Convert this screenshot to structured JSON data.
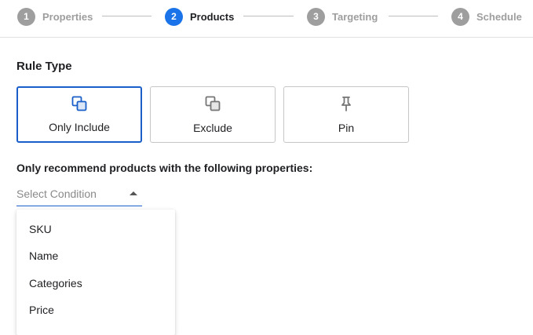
{
  "stepper": {
    "steps": [
      {
        "number": "1",
        "label": "Properties",
        "state": "inactive"
      },
      {
        "number": "2",
        "label": "Products",
        "state": "active"
      },
      {
        "number": "3",
        "label": "Targeting",
        "state": "inactive"
      },
      {
        "number": "4",
        "label": "Schedule",
        "state": "inactive"
      }
    ]
  },
  "rule_type": {
    "title": "Rule Type",
    "options": [
      {
        "label": "Only Include",
        "icon": "layers-filled-icon",
        "selected": true
      },
      {
        "label": "Exclude",
        "icon": "layers-outline-icon",
        "selected": false
      },
      {
        "label": "Pin",
        "icon": "pin-icon",
        "selected": false
      }
    ]
  },
  "condition": {
    "label": "Only recommend products with the following properties:",
    "placeholder": "Select Condition",
    "options": [
      "SKU",
      "Name",
      "Categories",
      "Price"
    ]
  },
  "colors": {
    "accent": "#1a73e8",
    "selected_border": "#1a5fc9",
    "inactive_step": "#9e9e9e"
  }
}
